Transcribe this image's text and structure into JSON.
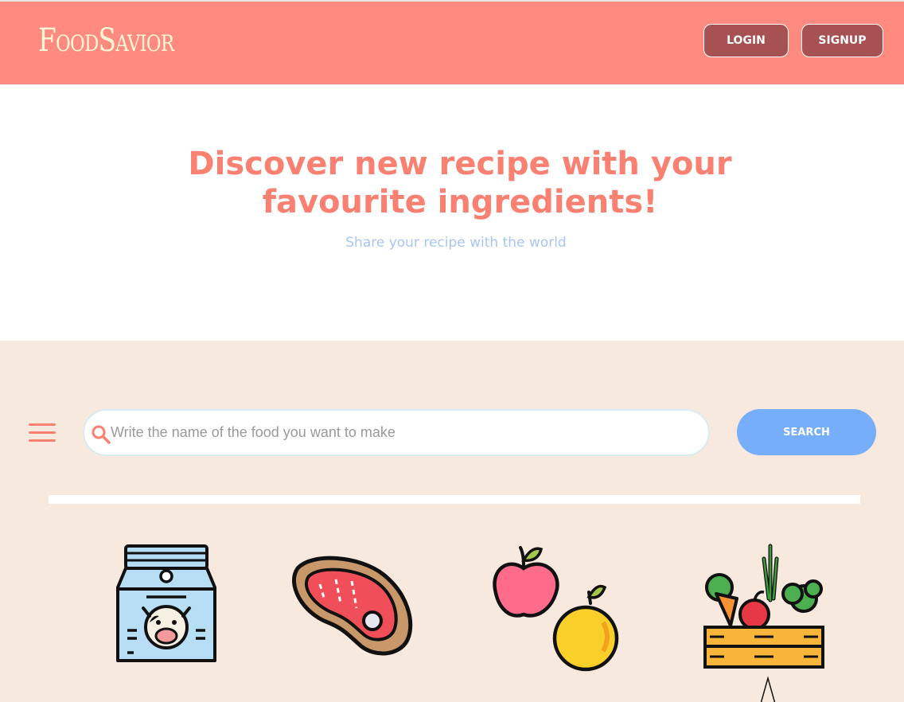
{
  "header": {
    "logo": "FoodSavior",
    "login_label": "LOGIN",
    "signup_label": "SIGNUP"
  },
  "hero": {
    "title_line1": "Discover new recipe with your",
    "title_line2": "favourite ingredients!",
    "subtitle": "Share your recipe with the world"
  },
  "search": {
    "placeholder": "Write the name of the food you want to make",
    "value": "",
    "button_label": "SEARCH"
  },
  "categories": [
    {
      "icon": "milk-carton-icon"
    },
    {
      "icon": "steak-icon"
    },
    {
      "icon": "fruit-icon"
    },
    {
      "icon": "vegetable-crate-icon"
    }
  ],
  "colors": {
    "header_bg": "#ff8a80",
    "accent": "#fa8072",
    "button_dark": "#a75252",
    "search_button": "#76aefc",
    "main_bg": "#f8e9df"
  }
}
